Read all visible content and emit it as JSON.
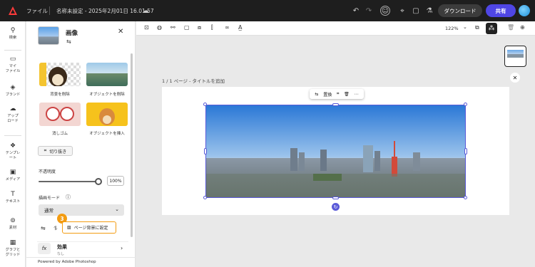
{
  "topbar": {
    "file_label": "ファイル",
    "doc_title": "名称未設定 - 2025年2月01日 16.01.57",
    "download_label": "ダウンロード",
    "share_label": "共有"
  },
  "leftnav": [
    {
      "icon": "search-icon",
      "glyph": "⚲",
      "label": "検索"
    },
    {
      "icon": "folder-icon",
      "glyph": "▭",
      "label": "マイ\nファイル"
    },
    {
      "icon": "brand-icon",
      "glyph": "◈",
      "label": "ブランド"
    },
    {
      "icon": "upload-cloud-icon",
      "glyph": "☁",
      "label": "アップ\nロード"
    },
    {
      "icon": "templates-icon",
      "glyph": "❖",
      "label": "テンプレ\nート"
    },
    {
      "icon": "media-icon",
      "glyph": "▣",
      "label": "メディア"
    },
    {
      "icon": "text-icon",
      "glyph": "T",
      "label": "テキスト"
    },
    {
      "icon": "elements-icon",
      "glyph": "⊚",
      "label": "素材"
    },
    {
      "icon": "grid-icon",
      "glyph": "▦",
      "label": "グラフと\nグリッド"
    }
  ],
  "panel": {
    "title": "画像",
    "tiles": [
      {
        "label": "背景を削除"
      },
      {
        "label": "オブジェクトを削除"
      },
      {
        "label": "消しゴム"
      },
      {
        "label": "オブジェクトを挿入"
      }
    ],
    "crop_label": "切り抜き",
    "opacity_label": "不透明度",
    "opacity_value": "100%",
    "blend_label": "描画モード",
    "blend_value": "通常",
    "badge_number": "3",
    "set_bg_label": "ページ背景に設定",
    "effects_label": "効果",
    "effects_sub": "なし",
    "footer": "Powered by Adobe Photoshop"
  },
  "toolbar": {
    "zoom": "122%"
  },
  "canvas": {
    "page_label": "1 / 1 ページ - タイトルを追加",
    "context_replace": "置換"
  },
  "colors": {
    "accent": "#4f46e5",
    "badge": "#f39c12",
    "selection": "#5a5ad8"
  }
}
